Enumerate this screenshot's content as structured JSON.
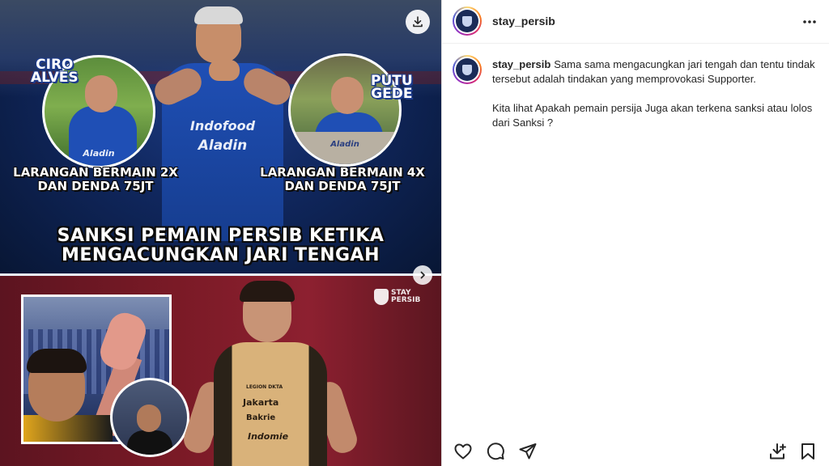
{
  "post": {
    "username": "stay_persib",
    "caption": {
      "username": "stay_persib",
      "paragraph1": "Sama sama mengacungkan jari tengah dan tentu tindak tersebut adalah tindakan yang memprovokasi Supporter.",
      "paragraph2": "Kita lihat Apakah pemain persija Juga akan terkena sanksi atau lolos dari Sanksi ?"
    }
  },
  "media": {
    "top": {
      "left_player_name_line1": "CIRO",
      "left_player_name_line2": "ALVES",
      "right_player_name_line1": "PUTU",
      "right_player_name_line2": "GEDE",
      "left_sanction_line1": "LARANGAN BERMAIN 2X",
      "left_sanction_line2": "DAN DENDA 75JT",
      "right_sanction_line1": "LARANGAN BERMAIN 4X",
      "right_sanction_line2": "DAN DENDA 75JT",
      "headline_line1": "SANKSI PEMAIN PERSIB KETIKA",
      "headline_line2": "MENGACUNGKAN JARI TENGAH",
      "jersey_sponsor1": "Indofood",
      "jersey_sponsor2": "Aladin",
      "circle_left_sponsor": "Aladin",
      "circle_right_sponsor": "Aladin"
    },
    "bottom": {
      "watermark_line1": "STAY",
      "watermark_line2": "PERSIB",
      "jersey_club": "LEGION DKTA",
      "jersey_sponsor1": "Jakarta",
      "jersey_sponsor2": "Bakrie",
      "jersey_sponsor3": "Indomie"
    }
  },
  "icons": {
    "download": "download-icon",
    "next": "chevron-right-icon",
    "more": "more-horizontal-icon",
    "like": "heart-icon",
    "comment": "comment-icon",
    "share": "send-icon",
    "save_download": "download-save-icon",
    "bookmark": "bookmark-icon"
  },
  "colors": {
    "text": "#262626",
    "persib_blue": "#1f4fb5",
    "border": "#dbdbdb"
  }
}
